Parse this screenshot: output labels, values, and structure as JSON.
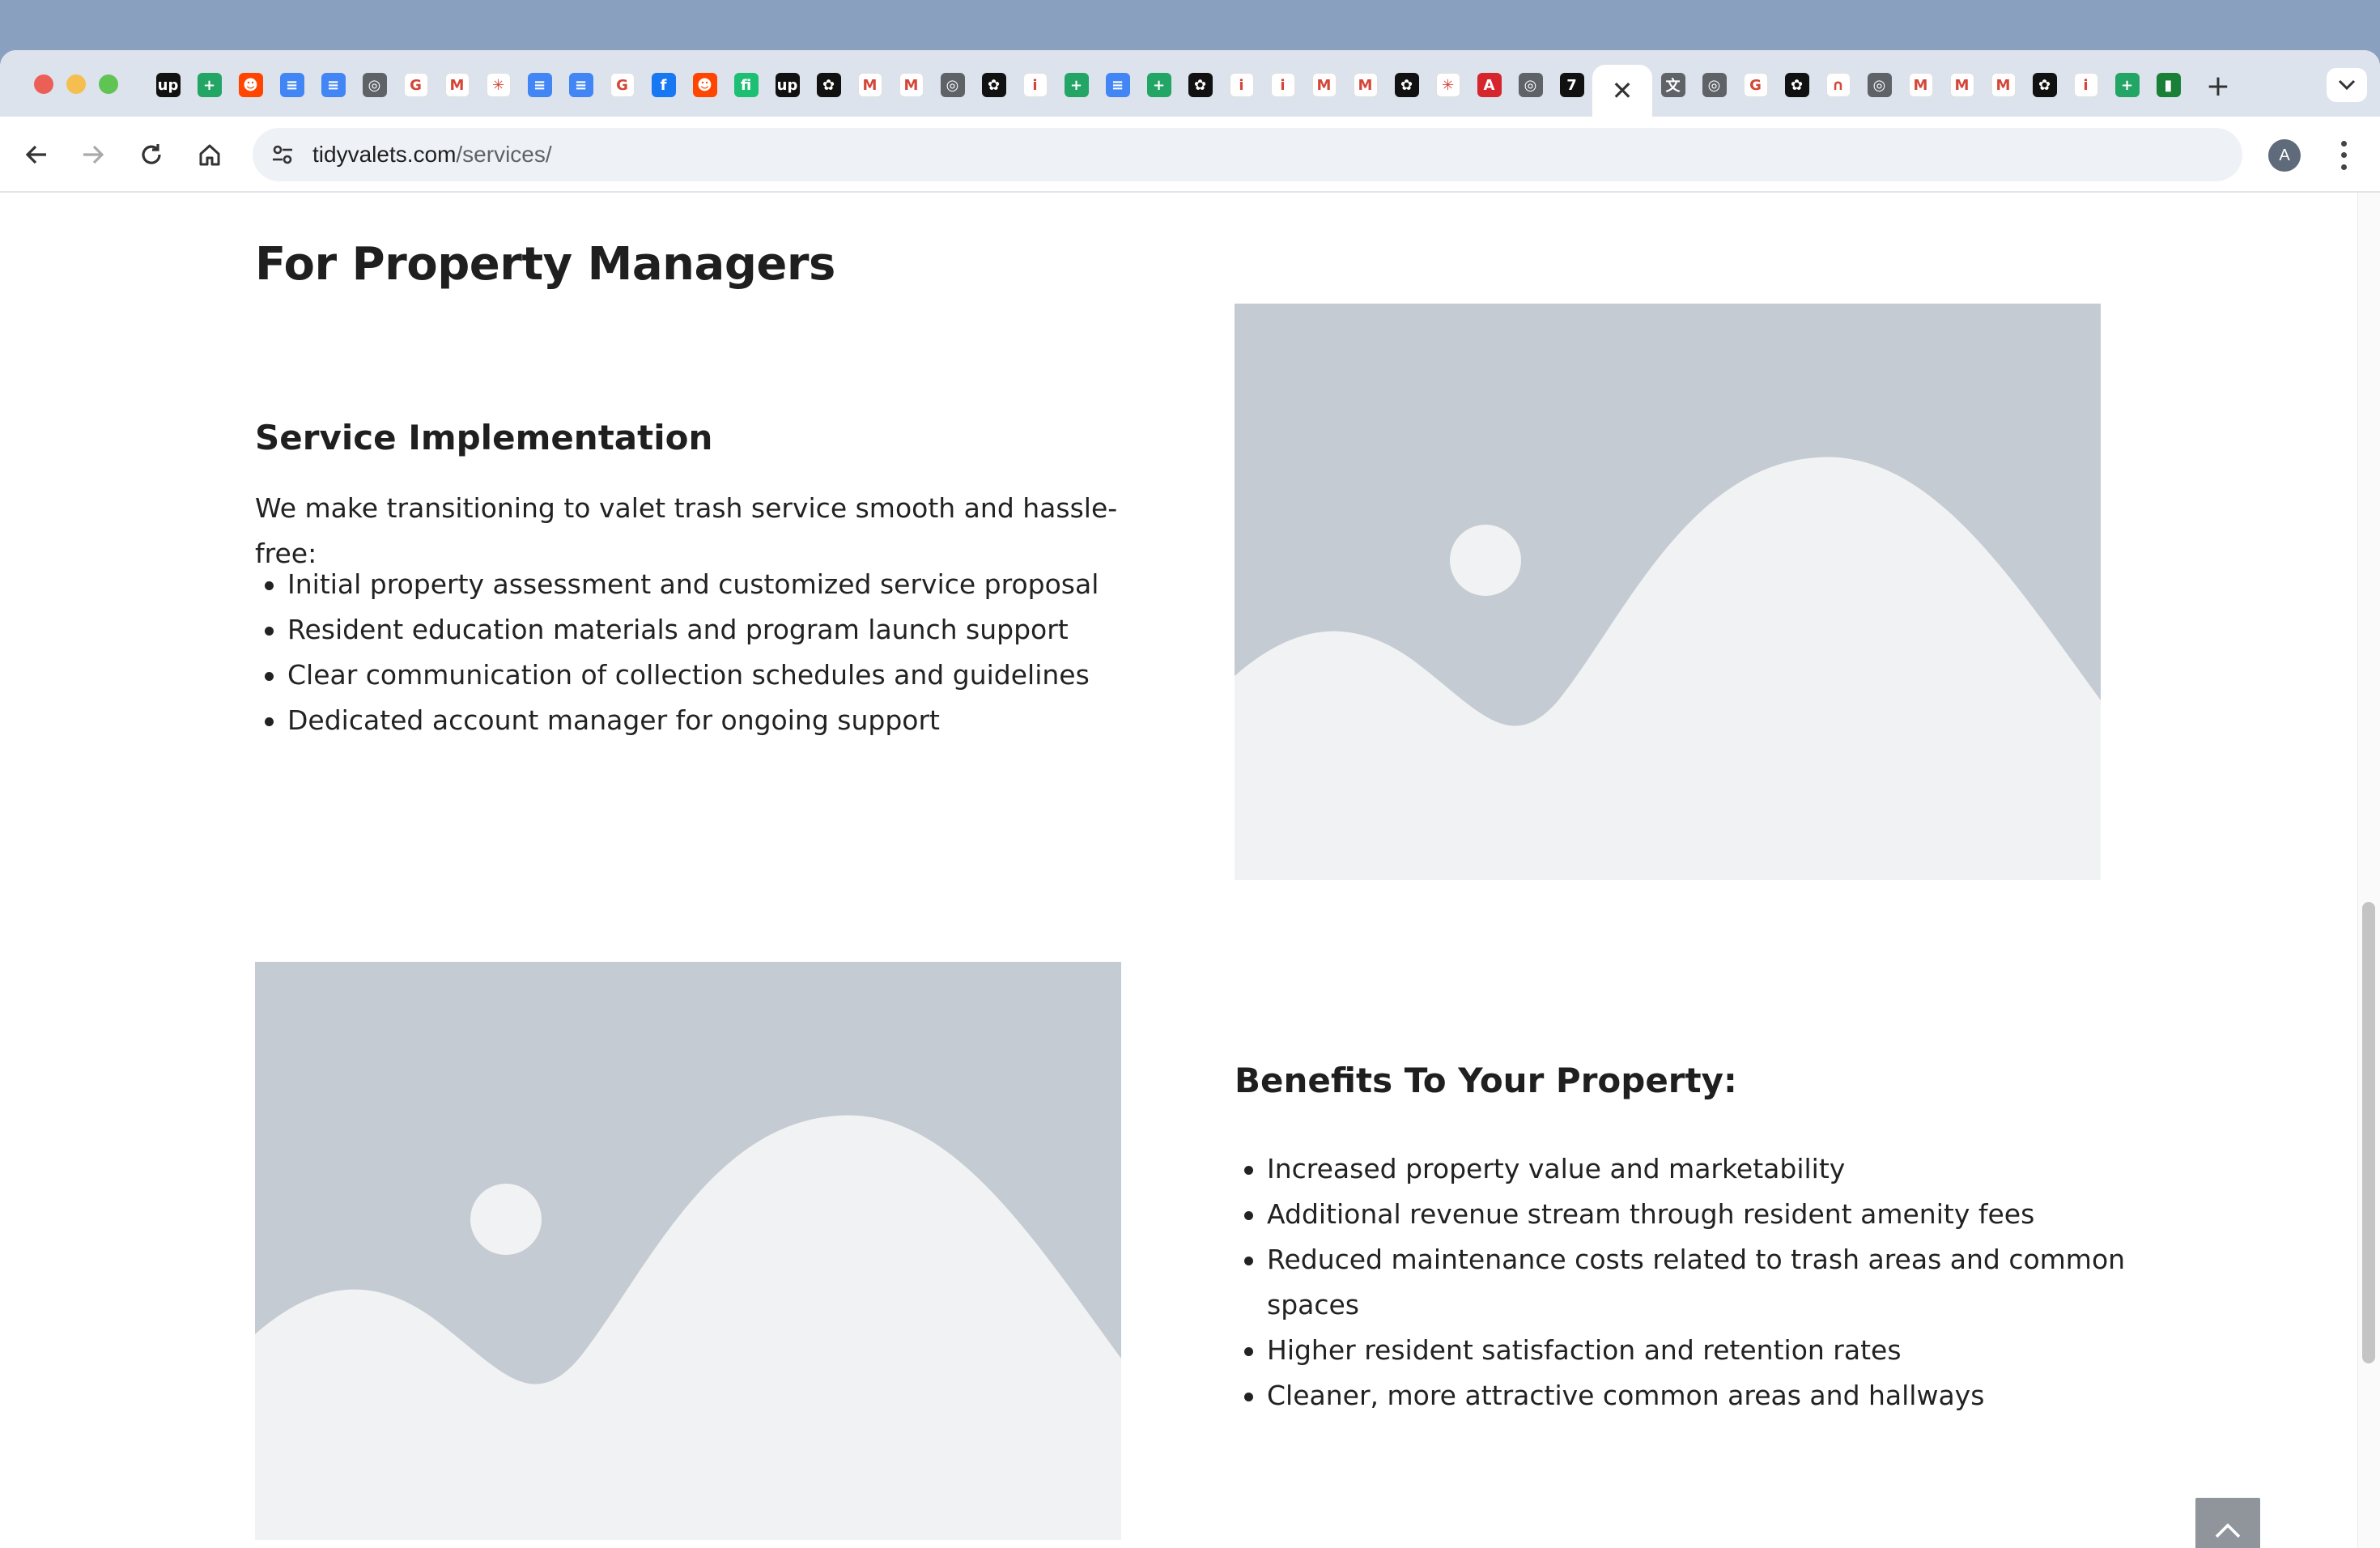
{
  "browser": {
    "tabs": [
      {
        "icon": "upwork-icon",
        "color": "#111111",
        "glyph": "up"
      },
      {
        "icon": "google-sheets-icon",
        "color": "#23a566",
        "glyph": "+"
      },
      {
        "icon": "reddit-icon",
        "color": "#ff4500",
        "glyph": "☻"
      },
      {
        "icon": "google-docs-icon",
        "color": "#4285f4",
        "glyph": "≡"
      },
      {
        "icon": "google-docs-icon",
        "color": "#4285f4",
        "glyph": "≡"
      },
      {
        "icon": "chrome-icon",
        "color": "#5f6368",
        "glyph": "◎"
      },
      {
        "icon": "google-icon",
        "color": "#ffffff",
        "glyph": "G"
      },
      {
        "icon": "gmail-icon",
        "color": "#ffffff",
        "glyph": "M"
      },
      {
        "icon": "claude-icon",
        "color": "#ffffff",
        "glyph": "✳"
      },
      {
        "icon": "google-docs-icon",
        "color": "#4285f4",
        "glyph": "≡"
      },
      {
        "icon": "google-docs-icon",
        "color": "#4285f4",
        "glyph": "≡"
      },
      {
        "icon": "google-icon",
        "color": "#ffffff",
        "glyph": "G"
      },
      {
        "icon": "facebook-icon",
        "color": "#1877f2",
        "glyph": "f"
      },
      {
        "icon": "reddit-icon",
        "color": "#ff4500",
        "glyph": "☻"
      },
      {
        "icon": "fiverr-icon",
        "color": "#1dbf73",
        "glyph": "fi"
      },
      {
        "icon": "upwork-icon",
        "color": "#111111",
        "glyph": "up"
      },
      {
        "icon": "openai-icon",
        "color": "#111111",
        "glyph": "✿"
      },
      {
        "icon": "gmail-icon",
        "color": "#ffffff",
        "glyph": "M"
      },
      {
        "icon": "gmail-icon",
        "color": "#ffffff",
        "glyph": "M"
      },
      {
        "icon": "chrome-icon",
        "color": "#5f6368",
        "glyph": "◎"
      },
      {
        "icon": "openai-icon",
        "color": "#111111",
        "glyph": "✿"
      },
      {
        "icon": "info-icon",
        "color": "#ffffff",
        "glyph": "i"
      },
      {
        "icon": "google-sheets-icon",
        "color": "#23a566",
        "glyph": "+"
      },
      {
        "icon": "google-docs-icon",
        "color": "#4285f4",
        "glyph": "≡"
      },
      {
        "icon": "google-sheets-icon",
        "color": "#23a566",
        "glyph": "+"
      },
      {
        "icon": "openai-icon",
        "color": "#111111",
        "glyph": "✿"
      },
      {
        "icon": "info-icon",
        "color": "#ffffff",
        "glyph": "i"
      },
      {
        "icon": "info-icon",
        "color": "#ffffff",
        "glyph": "i"
      },
      {
        "icon": "gmail-icon",
        "color": "#ffffff",
        "glyph": "M"
      },
      {
        "icon": "gmail-icon",
        "color": "#ffffff",
        "glyph": "M"
      },
      {
        "icon": "openai-icon",
        "color": "#111111",
        "glyph": "✿"
      },
      {
        "icon": "claude-icon",
        "color": "#ffffff",
        "glyph": "✳"
      },
      {
        "icon": "acrobat-icon",
        "color": "#d4262c",
        "glyph": "A"
      },
      {
        "icon": "chrome-icon",
        "color": "#5f6368",
        "glyph": "◎"
      },
      {
        "icon": "notification-icon",
        "color": "#111111",
        "glyph": "7"
      },
      {
        "icon": "close-icon",
        "active": true
      },
      {
        "icon": "translate-icon",
        "color": "#5f6368",
        "glyph": "文"
      },
      {
        "icon": "chrome-icon",
        "color": "#5f6368",
        "glyph": "◎"
      },
      {
        "icon": "google-icon",
        "color": "#ffffff",
        "glyph": "G"
      },
      {
        "icon": "openai-icon",
        "color": "#111111",
        "glyph": "✿"
      },
      {
        "icon": "magnet-icon",
        "color": "#ffffff",
        "glyph": "∩"
      },
      {
        "icon": "chrome-icon",
        "color": "#5f6368",
        "glyph": "◎"
      },
      {
        "icon": "gmail-icon",
        "color": "#ffffff",
        "glyph": "M"
      },
      {
        "icon": "gmail-icon",
        "color": "#ffffff",
        "glyph": "M"
      },
      {
        "icon": "gmail-icon",
        "color": "#ffffff",
        "glyph": "M"
      },
      {
        "icon": "openai-icon",
        "color": "#111111",
        "glyph": "✿"
      },
      {
        "icon": "info-icon",
        "color": "#ffffff",
        "glyph": "i"
      },
      {
        "icon": "google-sheets-icon",
        "color": "#23a566",
        "glyph": "+"
      },
      {
        "icon": "evernote-icon",
        "color": "#1a7f37",
        "glyph": "▮"
      }
    ],
    "new_tab_label": "+",
    "tab_search_icon": "chevron-down-icon",
    "url_host": "tidyvalets.com",
    "url_path": "/services/",
    "profile_initial": "A"
  },
  "page": {
    "section_title": "For Property Managers",
    "implementation": {
      "heading": "Service Implementation",
      "intro": "We make transitioning to valet trash service smooth and hassle-free:",
      "items": [
        "Initial property assessment and customized service proposal",
        "Resident education materials and program launch support",
        "Clear communication of collection schedules and guidelines",
        "Dedicated account manager for ongoing support"
      ]
    },
    "benefits": {
      "heading": "Benefits To Your Property:",
      "items": [
        "Increased property value and marketability",
        "Additional revenue stream through resident amenity fees",
        "Reduced maintenance costs related to trash areas and common spaces",
        "Higher resident satisfaction and retention rates",
        "Cleaner, more attractive common areas and hallways"
      ]
    }
  },
  "colors": {
    "placeholder_bg": "#c4cbd2",
    "placeholder_fg": "#f1f2f3",
    "back_to_top": "#8f959b"
  }
}
